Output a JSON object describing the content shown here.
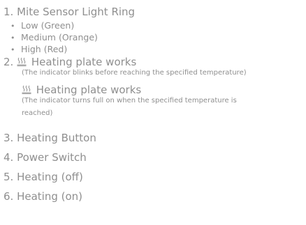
{
  "items": {
    "item1": "1. Mite Sensor Light Ring",
    "low": "Low (Green)",
    "medium": "Medium (Orange)",
    "high": "High (Red)",
    "item2_prefix": "2.",
    "heating_works_1": "Heating plate works",
    "note_1": "(The indicator blinks before reaching the specified temperature)",
    "heating_works_2": "Heating plate works",
    "note_2_line1": "(The indicator turns full on when the specified temperature is",
    "note_2_line2": "reached)",
    "item3": "3. Heating Button",
    "item4": "4. Power Switch",
    "item5": "5. Heating (off)",
    "item6": "6. Heating (on)"
  },
  "icons": {
    "heating": "heating-plate-icon"
  }
}
